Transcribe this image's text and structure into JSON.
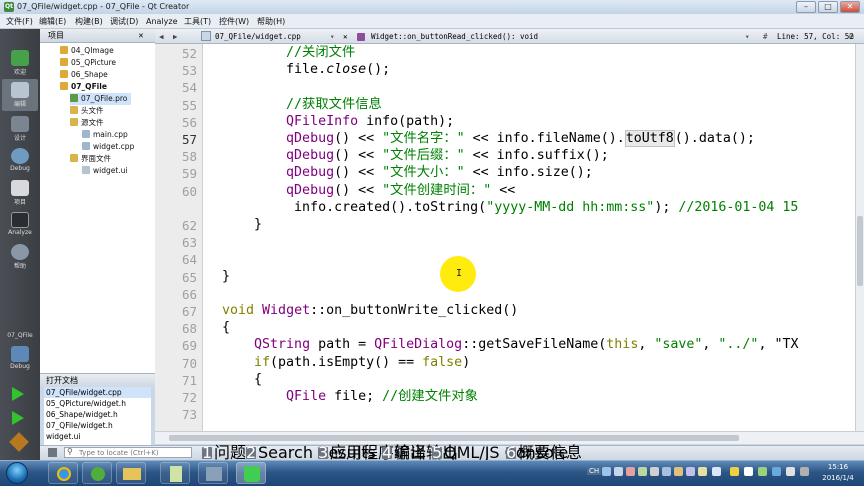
{
  "window": {
    "title": "07_QFile/widget.cpp - 07_QFile - Qt Creator",
    "app_icon": "Qt",
    "buttons": [
      "–",
      "□",
      "✕"
    ]
  },
  "menubar": [
    "文件(F)",
    "编辑(E)",
    "构建(B)",
    "调试(D)",
    "Analyze",
    "工具(T)",
    "控件(W)",
    "帮助(H)"
  ],
  "modes": [
    {
      "label": "欢迎",
      "icon": "qt-logo-icon"
    },
    {
      "label": "编辑",
      "icon": "edit-icon",
      "selected": true
    },
    {
      "label": "设计",
      "icon": "design-icon"
    },
    {
      "label": "Debug",
      "icon": "debug-icon"
    },
    {
      "label": "项目",
      "icon": "project-icon"
    },
    {
      "label": "Analyze",
      "icon": "analyze-icon"
    },
    {
      "label": "帮助",
      "icon": "help-icon"
    }
  ],
  "build": {
    "target_label": "07_QFile",
    "kit_label": "Debug"
  },
  "project_panel": {
    "title": "项目"
  },
  "project_tree": [
    {
      "label": "04_QImage",
      "level": 1
    },
    {
      "label": "05_QPicture",
      "level": 1
    },
    {
      "label": "06_Shape",
      "level": 1
    },
    {
      "label": "07_QFile",
      "level": 1,
      "bold": true
    },
    {
      "label": "07_QFile.pro",
      "level": 2,
      "selected": true
    },
    {
      "label": "头文件",
      "level": 2
    },
    {
      "label": "源文件",
      "level": 2
    },
    {
      "label": "main.cpp",
      "level": 3
    },
    {
      "label": "widget.cpp",
      "level": 3
    },
    {
      "label": "界面文件",
      "level": 2
    },
    {
      "label": "widget.ui",
      "level": 3
    }
  ],
  "open_docs": {
    "title": "打开文档",
    "items": [
      "07_QFile/widget.cpp",
      "05_QPicture/widget.h",
      "06_Shape/widget.h",
      "07_QFile/widget.h",
      "widget.ui"
    ]
  },
  "editor": {
    "file_tab": "07_QFile/widget.cpp",
    "function": "Widget::on_buttonRead_clicked(): void",
    "position": "Line: 57, Col: 52",
    "current_line": 57,
    "line_numbers": [
      52,
      53,
      54,
      55,
      56,
      57,
      58,
      59,
      60,
      "",
      62,
      63,
      64,
      65,
      66,
      67,
      68,
      69,
      70,
      71,
      72,
      73
    ],
    "lines": [
      "        //关闭文件",
      "        file.close();",
      "",
      "        //获取文件信息",
      "        QFileInfo info(path);",
      "        qDebug() << \"文件名字：\" << info.fileName().toUtf8().data();",
      "        qDebug() << \"文件后缀：\" << info.suffix();",
      "        qDebug() << \"文件大小：\" << info.size();",
      "        qDebug() << \"文件创建时间：\" <<",
      "         info.created().toString(\"yyyy-MM-dd hh:mm:ss\"); //2016-01-04 15",
      "    }",
      "",
      "",
      "}",
      "",
      "void Widget::on_buttonWrite_clicked()",
      "{",
      "    QString path = QFileDialog::getSaveFileName(this, \"save\", \"../\", \"TX",
      "    if(path.isEmpty() == false)",
      "    {",
      "        QFile file; //创建文件对象"
    ]
  },
  "search": {
    "placeholder": "Type to locate (Ctrl+K)"
  },
  "output_tabs": [
    {
      "num": "1",
      "label": "问题"
    },
    {
      "num": "2",
      "label": "Search Results"
    },
    {
      "num": "3",
      "label": "应用程序输出"
    },
    {
      "num": "4",
      "label": "编译输出"
    },
    {
      "num": "5",
      "label": "QML/JS Console"
    },
    {
      "num": "6",
      "label": "概要信息"
    }
  ],
  "taskbar": {
    "time": "15:16",
    "date": "2016/1/4",
    "lang": "CH"
  }
}
